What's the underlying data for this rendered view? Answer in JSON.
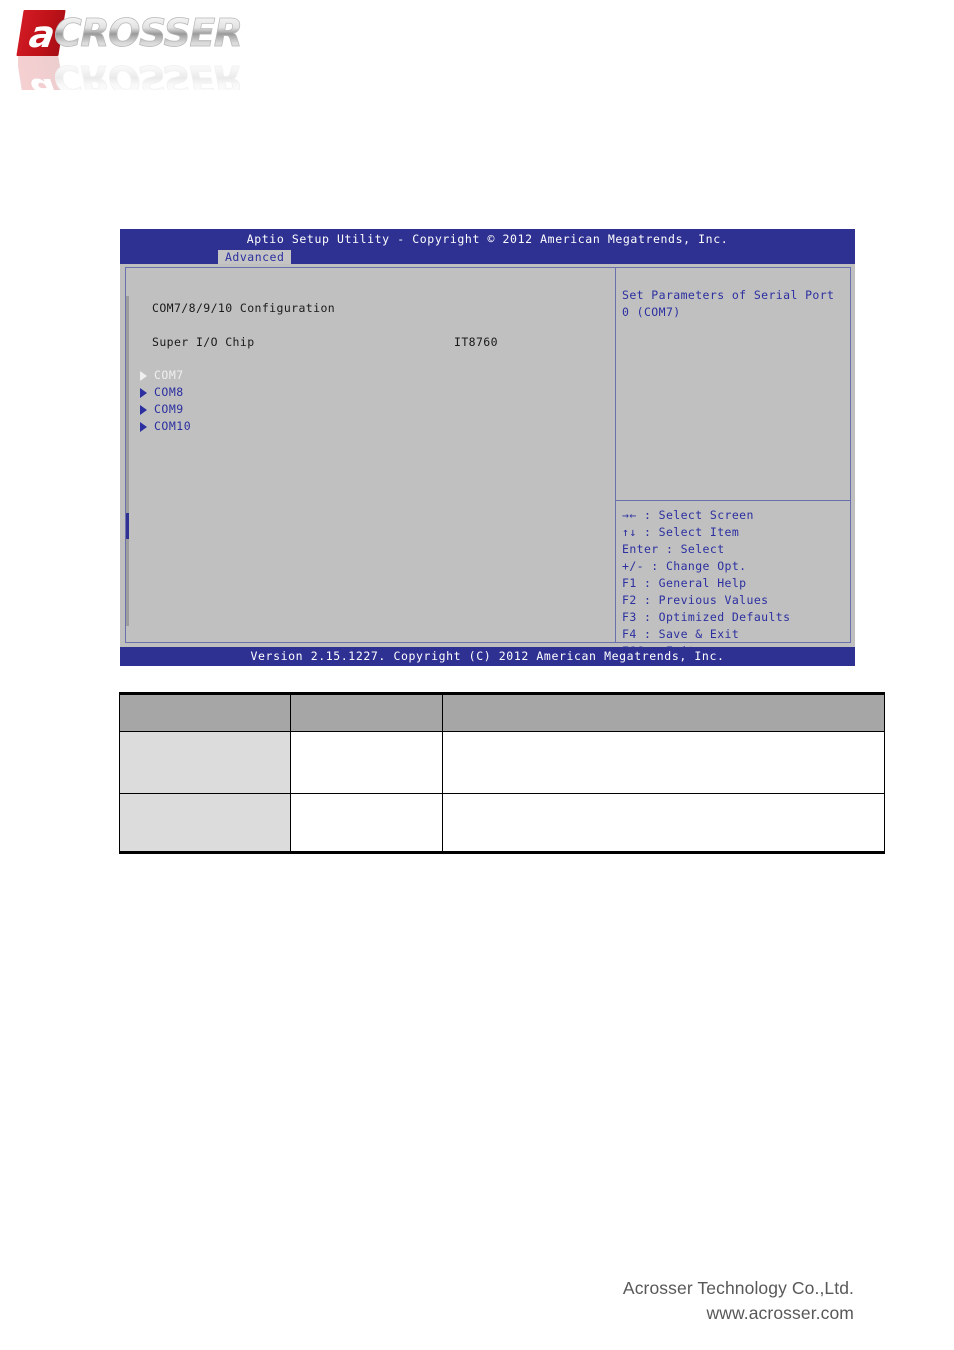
{
  "brand": {
    "logo_mark": "a",
    "logo_word": "CROSSER",
    "logo_name": "ACROSSER"
  },
  "bios": {
    "title": "Aptio Setup Utility - Copyright © 2012 American Megatrends, Inc.",
    "tabs": [
      {
        "label": "Advanced",
        "active": true
      }
    ],
    "section_title": "COM7/8/9/10 Configuration",
    "info_rows": [
      {
        "label": "Super I/O Chip",
        "value": "IT8760"
      }
    ],
    "menu_items": [
      {
        "label": "COM7",
        "selected": true
      },
      {
        "label": "COM8",
        "selected": false
      },
      {
        "label": "COM9",
        "selected": false
      },
      {
        "label": "COM10",
        "selected": false
      }
    ],
    "help": {
      "description": "Set Parameters of Serial Port 0 (COM7)",
      "keys": [
        "→← : Select Screen",
        "↑↓ : Select Item",
        "Enter : Select",
        "+/- : Change Opt.",
        "F1 : General Help",
        "F2 : Previous Values",
        "F3 : Optimized Defaults",
        "F4 : Save & Exit",
        "ESC : Exit"
      ]
    },
    "version_bar": "Version 2.15.1227. Copyright (C) 2012 American Megatrends, Inc.",
    "colors": {
      "titlebar": "#2e3192",
      "panel": "#c0c0c0",
      "text_blue": "#2b2fa0",
      "text_selected": "#efefef"
    }
  },
  "table": {
    "headers": [
      "",
      "",
      ""
    ],
    "rows": [
      [
        "",
        "",
        ""
      ],
      [
        "",
        "",
        ""
      ]
    ]
  },
  "footer": {
    "company": "Acrosser Technology Co.,Ltd.",
    "website": "www.acrosser.com"
  }
}
